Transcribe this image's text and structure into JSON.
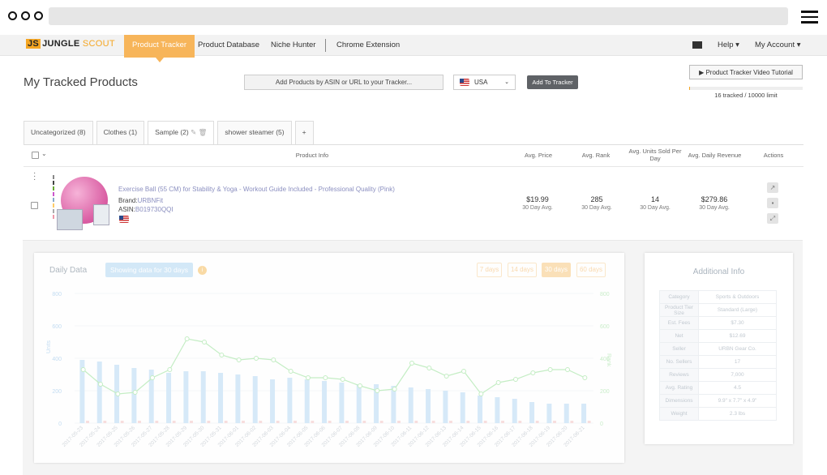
{
  "nav": {
    "logo_js": "JS",
    "logo_jungle": "JUNGLE",
    "logo_scout": "SCOUT",
    "items": [
      "Product Tracker",
      "Product Database",
      "Niche Hunter",
      "Chrome Extension"
    ],
    "help": "Help ▾",
    "account": "My Account ▾"
  },
  "header": {
    "title": "My Tracked Products",
    "add_placeholder": "Add Products by ASIN or URL to your Tracker...",
    "country": "USA",
    "add_button": "Add To Tracker",
    "tutorial": "▶  Product Tracker Video Tutorial",
    "tracked": "16 tracked / 10000 limit",
    "tracked_fraction": 0.0016
  },
  "tabs": [
    "Uncategorized (8)",
    "Clothes (1)",
    "Sample (2)",
    "shower steamer (5)",
    "+"
  ],
  "columns": {
    "product": "Product Info",
    "price": "Avg. Price",
    "rank": "Avg. Rank",
    "units": "Avg. Units Sold Per Day",
    "revenue": "Avg. Daily Revenue",
    "actions": "Actions"
  },
  "product": {
    "title": "Exercise Ball (55 CM) for Stability & Yoga - Workout Guide Included - Professional Quality (Pink)",
    "brand_label": "Brand:",
    "brand": "URBNFit",
    "asin_label": "ASIN:",
    "asin": "B019730QQI",
    "price": "$19.99",
    "rank": "285",
    "units": "14",
    "revenue": "$279.86",
    "sub": "30 Day Avg."
  },
  "daily": {
    "title": "Daily Data",
    "showing": "Showing data for 30 days",
    "info": "i",
    "ranges": [
      "7 days",
      "14 days",
      "30 days",
      "60 days"
    ]
  },
  "additional": {
    "title": "Additional Info",
    "rows": [
      [
        "Category",
        "Sports & Outdoors"
      ],
      [
        "Product Tier Size",
        "Standard (Large)"
      ],
      [
        "Est. Fees",
        "$7.30"
      ],
      [
        "Net",
        "$12.69"
      ],
      [
        "Seller",
        "URBN Gear Co."
      ],
      [
        "No. Sellers",
        "17"
      ],
      [
        "Reviews",
        "7,000"
      ],
      [
        "Avg. Rating",
        "4.5"
      ],
      [
        "Dimensions",
        "9.9\" x 7.7\" x 4.9\""
      ],
      [
        "Weight",
        "2.3 lbs"
      ]
    ]
  },
  "chart_data": {
    "type": "bar",
    "ylabel": "Units",
    "y2label": "Rank",
    "ylim": [
      0,
      800
    ],
    "y2lim": [
      0,
      800
    ],
    "yticks": [
      "0",
      "200",
      "400",
      "600",
      "800"
    ],
    "categories": [
      "2017-05-23",
      "2017-05-24",
      "2017-05-25",
      "2017-05-26",
      "2017-05-27",
      "2017-05-28",
      "2017-05-29",
      "2017-05-30",
      "2017-05-31",
      "2017-06-01",
      "2017-06-02",
      "2017-06-03",
      "2017-06-04",
      "2017-06-05",
      "2017-06-06",
      "2017-06-07",
      "2017-06-08",
      "2017-06-09",
      "2017-06-10",
      "2017-06-11",
      "2017-06-12",
      "2017-06-13",
      "2017-06-14",
      "2017-06-15",
      "2017-06-16",
      "2017-06-17",
      "2017-06-18",
      "2017-06-19",
      "2017-06-20",
      "2017-06-21"
    ],
    "series": [
      {
        "name": "Units",
        "values": [
          390,
          380,
          360,
          340,
          330,
          310,
          320,
          320,
          310,
          300,
          290,
          270,
          280,
          270,
          260,
          250,
          240,
          240,
          230,
          220,
          210,
          200,
          190,
          170,
          160,
          150,
          130,
          120,
          120,
          120
        ]
      },
      {
        "name": "Rank",
        "values": [
          330,
          240,
          180,
          190,
          280,
          330,
          520,
          500,
          420,
          390,
          400,
          390,
          320,
          280,
          280,
          270,
          230,
          200,
          210,
          370,
          340,
          290,
          320,
          180,
          250,
          270,
          310,
          330,
          330,
          280
        ]
      }
    ]
  }
}
